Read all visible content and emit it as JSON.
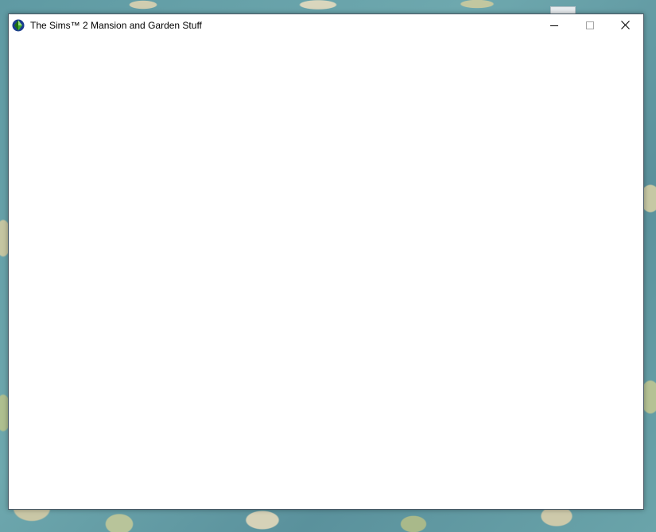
{
  "window": {
    "title": "The Sims™ 2 Mansion and Garden Stuff",
    "app_icon": "sims-plumbob-icon",
    "controls": {
      "minimize_icon": "minimize-icon",
      "maximize_icon": "maximize-icon",
      "maximize_enabled": false,
      "close_icon": "close-icon"
    }
  },
  "colors": {
    "plumbob_green": "#3fae2a",
    "plumbob_dark": "#1c6b16",
    "plumbob_blue": "#2a63c9"
  }
}
